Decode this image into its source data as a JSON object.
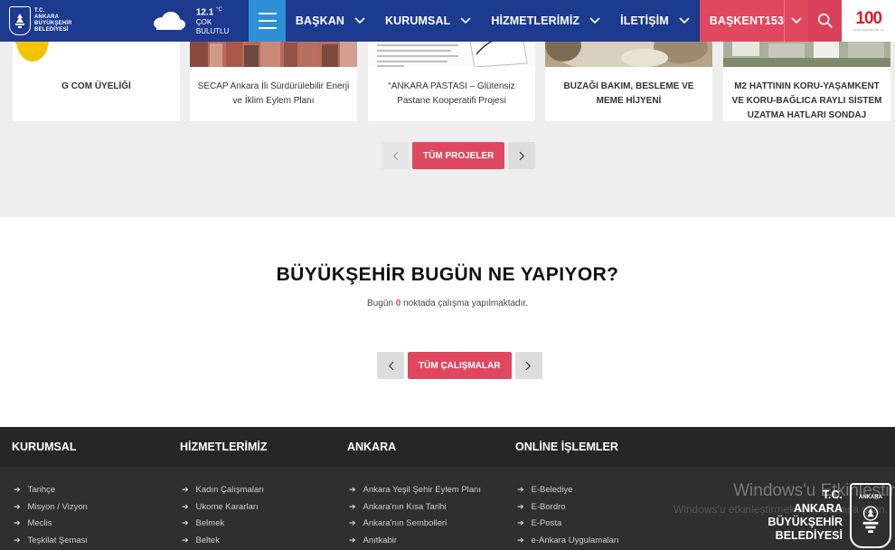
{
  "header": {
    "logo": {
      "line1": "T.C.",
      "line2": "ANKARA",
      "line3": "BÜYÜKŞEHİR",
      "line4": "BELEDİYESİ"
    },
    "weather": {
      "temp": "12.1",
      "unit": "°C",
      "cond1": "ÇOK",
      "cond2": "BULUTLU",
      "icon": "cloud-icon"
    },
    "nav": [
      {
        "label": "BAŞKAN"
      },
      {
        "label": "KURUMSAL"
      },
      {
        "label": "HİZMETLERİMİZ"
      },
      {
        "label": "İLETİŞİM"
      },
      {
        "label": "BAŞKENT153"
      }
    ],
    "badge": {
      "number": "100",
      "sub": "cumhuriyetimizin 100. yılı"
    }
  },
  "projects": {
    "cards": [
      {
        "title": "G COM ÜYELİĞİ"
      },
      {
        "title": "SECAP Ankara İli Sürdürülebilir Enerji ve İklim Eylem Planı"
      },
      {
        "title": "“ANKARA PASTASI – Glütensiz Pastane Kooperatifi Projesi"
      },
      {
        "title": "BUZAĞI BAKIM, BESLEME VE MEME HİJYENİ"
      },
      {
        "title": "M2 HATTININ KORU-YAŞAMKENT VE KORU-BAĞLICA RAYLI SİSTEM UZATMA HATLARI SONDAJ"
      }
    ],
    "button": "TÜM PROJELER"
  },
  "bugun": {
    "title": "BÜYÜKŞEHİR BUGÜN NE YAPIYOR?",
    "text_before": "Bugün",
    "count": "0",
    "text_after": "noktada çalışma yapılmaktadır.",
    "button": "TÜM ÇALIŞMALAR"
  },
  "footer": {
    "columns": [
      {
        "heading": "KURUMSAL",
        "links": [
          "Tarihçe",
          "Misyon / Vizyon",
          "Meclis",
          "Teşkilat Şeması"
        ]
      },
      {
        "heading": "HİZMETLERİMİZ",
        "links": [
          "Kadın Çalışmaları",
          "Ukome Kararları",
          "Belmek",
          "Beltek"
        ]
      },
      {
        "heading": "ANKARA",
        "links": [
          "Ankara Yeşil Şehir Eylem Planı",
          "Ankara'nın Kısa Tarihi",
          "Ankara'nın Sembolleri",
          "Anıtkabir"
        ]
      },
      {
        "heading": "ONLİNE İŞLEMLER",
        "links": [
          "E-Belediye",
          "E-Bordro",
          "E-Posta",
          "e-Ankara Uygulamaları"
        ]
      }
    ],
    "logo": {
      "line1": "T.C.",
      "line2": "ANKARA",
      "line3": "BÜYÜKŞEHİR",
      "line4": "BELEDİYESİ",
      "badge_caption": "ANKARA"
    },
    "watermark": "Windows'u Etkinleştir",
    "watermark2": "Windows'u etkinleştirmek için Ayarlar'a gidin."
  },
  "colors": {
    "header": "#1c3a8e",
    "accent": "#e04860",
    "menu": "#2e90d4",
    "footer": "#2f2f2f"
  }
}
